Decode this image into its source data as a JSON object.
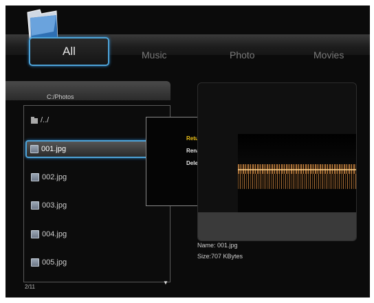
{
  "tabs": [
    {
      "label": "All",
      "selected": true
    },
    {
      "label": "Music",
      "selected": false
    },
    {
      "label": "Photo",
      "selected": false
    },
    {
      "label": "Movies",
      "selected": false
    }
  ],
  "browser": {
    "path": "C:/Photos",
    "up_label": "/../",
    "files": [
      "001.jpg",
      "002.jpg",
      "003.jpg",
      "004.jpg",
      "005.jpg"
    ],
    "selected_index": 0,
    "page_indicator": "2/11"
  },
  "context_menu": {
    "items": [
      "Return",
      "Rename",
      "Delete"
    ],
    "active_index": 0
  },
  "preview": {
    "name_text": "Name: 001.jpg",
    "size_text": "Size:707 KBytes"
  },
  "colors": {
    "accent": "#4ea4d9",
    "menu_active": "#f0c419",
    "background": "#0b0b0b"
  },
  "icons": [
    "folder-logo-icon",
    "folder-icon",
    "image-file-icon",
    "scroll-down-icon"
  ]
}
